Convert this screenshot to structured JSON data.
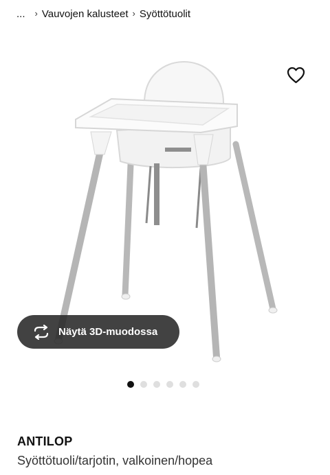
{
  "breadcrumb": {
    "ellipsis": "...",
    "items": [
      "Vauvojen kalusteet",
      "Syöttötuolit"
    ]
  },
  "product_image": {
    "icon": "high-chair-image"
  },
  "wishlist": {
    "icon": "heart-icon"
  },
  "view3d": {
    "label": "Näytä 3D-muodossa",
    "icon": "rotate-3d-icon"
  },
  "carousel": {
    "total": 6,
    "active_index": 0
  },
  "product": {
    "name": "ANTILOP",
    "description": "Syöttötuoli/tarjotin, valkoinen/hopea"
  },
  "colors": {
    "button_bg": "#282828",
    "dot_active": "#111111",
    "dot_inactive": "#dfdfdf"
  }
}
